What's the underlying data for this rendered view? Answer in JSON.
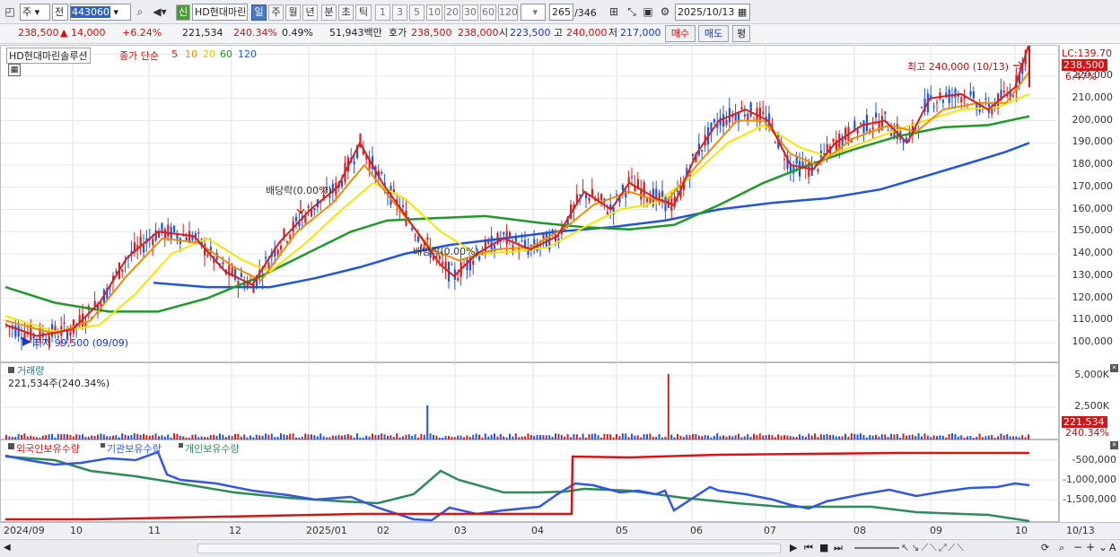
{
  "toolbar": {
    "period_code": "주",
    "price_label": "전",
    "code": "443060",
    "new_badge": "신",
    "stock_name": "HD현대마린",
    "periods": [
      "일",
      "주",
      "월",
      "년",
      "분",
      "초",
      "틱"
    ],
    "active_period": "일",
    "intervals": [
      "1",
      "3",
      "5",
      "10",
      "20",
      "30",
      "60",
      "120"
    ],
    "count_current": "265",
    "count_total": "/346",
    "date": "2025/10/13"
  },
  "quote": {
    "price": "238,500",
    "change": "▲ 14,000",
    "change_pct": "+6.24%",
    "volume": "221,534",
    "volume_ratio": "240.34%",
    "turnover": "0.49%",
    "amount": "51,943백만",
    "bid_label": "호가",
    "ask": "238,500",
    "bid": "238,000",
    "open_label": "시",
    "open": "223,500",
    "high_label": "고",
    "high": "240,000",
    "low_label": "저",
    "low": "217,000",
    "buy_label": "매수",
    "sell_label": "매도",
    "even_label": "평"
  },
  "price_pane": {
    "stock_tag": "HD현대마린솔루션",
    "indicator": "종가 단순",
    "ma_periods": [
      "5",
      "10",
      "20",
      "60",
      "120"
    ],
    "ma_colors": [
      "#d42020",
      "#f08c00",
      "#f5e500",
      "#1f9a2a",
      "#2255dd"
    ],
    "lc_label": "LC:139.70",
    "current_price": "238,500",
    "current_pct": "6.47%",
    "y_ticks": [
      "220,000",
      "210,000",
      "200,000",
      "190,000",
      "180,000",
      "170,000",
      "160,000",
      "150,000",
      "140,000",
      "130,000",
      "120,000",
      "110,000",
      "100,000"
    ],
    "annotations": {
      "high": "최고 240,000 (10/13)",
      "low": "최저 99,500 (09/09)",
      "dividend1": "배당락(0.00%)",
      "dividend2": "배당락(0.00%)"
    }
  },
  "volume_pane": {
    "title": "거래량",
    "value": "221,534주(240.34%)",
    "y_ticks": [
      "5,000K",
      "2,500K"
    ],
    "current": "221,534",
    "current_pct": "240.34%"
  },
  "holding_pane": {
    "series": [
      "외국인보유수량",
      "기관보유수량",
      "개인보유수량"
    ],
    "series_colors": [
      "#d41515",
      "#3358e0",
      "#2e8b57"
    ],
    "y_ticks": [
      "-500,000",
      "-1,000,000",
      "-1,500,000"
    ]
  },
  "x_axis": {
    "labels": [
      "2024/09",
      "10",
      "11",
      "12",
      "2025/01",
      "02",
      "03",
      "04",
      "05",
      "06",
      "07",
      "08",
      "09",
      "10"
    ],
    "axis_right": "10/13"
  },
  "chart_data": {
    "type": "line",
    "title": "HD현대마린솔루션",
    "x": [
      "2024/09/09",
      "2024/10",
      "2024/11",
      "2024/12",
      "2025/01",
      "2025/02",
      "2025/03",
      "2025/04",
      "2025/05",
      "2025/06",
      "2025/07",
      "2025/08",
      "2025/09",
      "2025/10/13"
    ],
    "series": [
      {
        "name": "5",
        "values": [
          100000,
          107000,
          150000,
          127000,
          148000,
          190000,
          135000,
          140000,
          165000,
          207000,
          185000,
          198000,
          215000,
          235000
        ]
      },
      {
        "name": "120",
        "values": [
          null,
          null,
          126000,
          124000,
          128000,
          136000,
          145000,
          148000,
          152000,
          158000,
          168000,
          174000,
          182000,
          190000
        ]
      }
    ],
    "ylim": [
      95000,
      245000
    ],
    "high": 240000,
    "low": 99500
  }
}
